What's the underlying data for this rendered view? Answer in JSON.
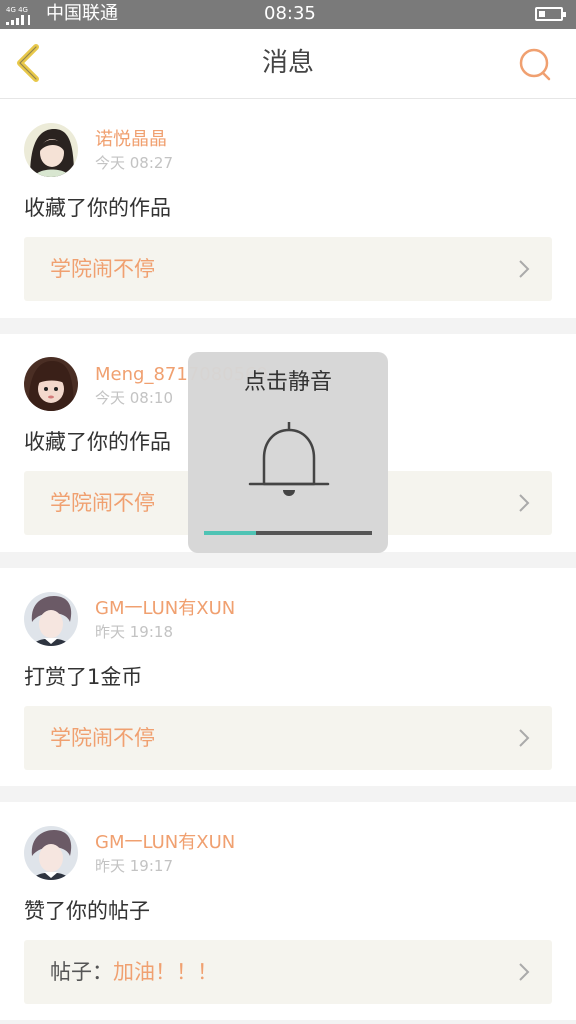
{
  "status_bar": {
    "network": "4G 4G",
    "carrier": "中国联通",
    "time": "08:35",
    "battery_level": 0.3
  },
  "header": {
    "title": "消息",
    "back_icon": "chevron-left-icon",
    "search_icon": "search-icon",
    "accent_color": "#f0a070",
    "back_color": "#e8c84a"
  },
  "messages": [
    {
      "username": "诺悦晶晶",
      "time": "今天 08:27",
      "action": "收藏了你的作品",
      "link_prefix": "",
      "link_text": "学院闹不停"
    },
    {
      "username": "Meng_8717080569",
      "time": "今天 08:10",
      "action": "收藏了你的作品",
      "link_prefix": "",
      "link_text": "学院闹不停"
    },
    {
      "username": "GM一LUN有XUN",
      "time": "昨天 19:18",
      "action": "打赏了1金币",
      "link_prefix": "",
      "link_text": "学院闹不停"
    },
    {
      "username": "GM一LUN有XUN",
      "time": "昨天 19:17",
      "action": "赞了你的帖子",
      "link_prefix": "帖子：",
      "link_text": "加油！！！"
    }
  ],
  "volume_overlay": {
    "label": "点击静音",
    "icon": "bell-icon",
    "level": 0.31,
    "fill_color": "#4ec3b4"
  }
}
